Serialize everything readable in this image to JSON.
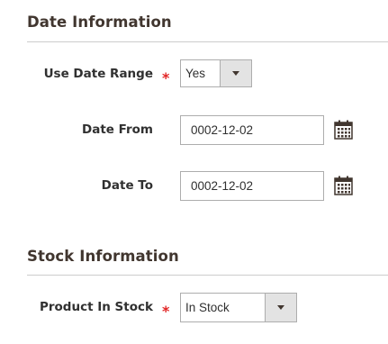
{
  "date_section": {
    "title": "Date Information",
    "use_date_range": {
      "label": "Use Date Range",
      "required_mark": "*",
      "value": "Yes"
    },
    "date_from": {
      "label": "Date From",
      "value": "0002-12-02",
      "icon": "calendar-icon"
    },
    "date_to": {
      "label": "Date To",
      "value": "0002-12-02",
      "icon": "calendar-icon"
    }
  },
  "stock_section": {
    "title": "Stock Information",
    "product_in_stock": {
      "label": "Product In Stock",
      "required_mark": "*",
      "value": "In Stock"
    }
  },
  "colors": {
    "required": "#e22626",
    "title": "#41362f",
    "border": "#adadad",
    "select_button_bg": "#e3e3e3",
    "divider": "#cccccc"
  }
}
